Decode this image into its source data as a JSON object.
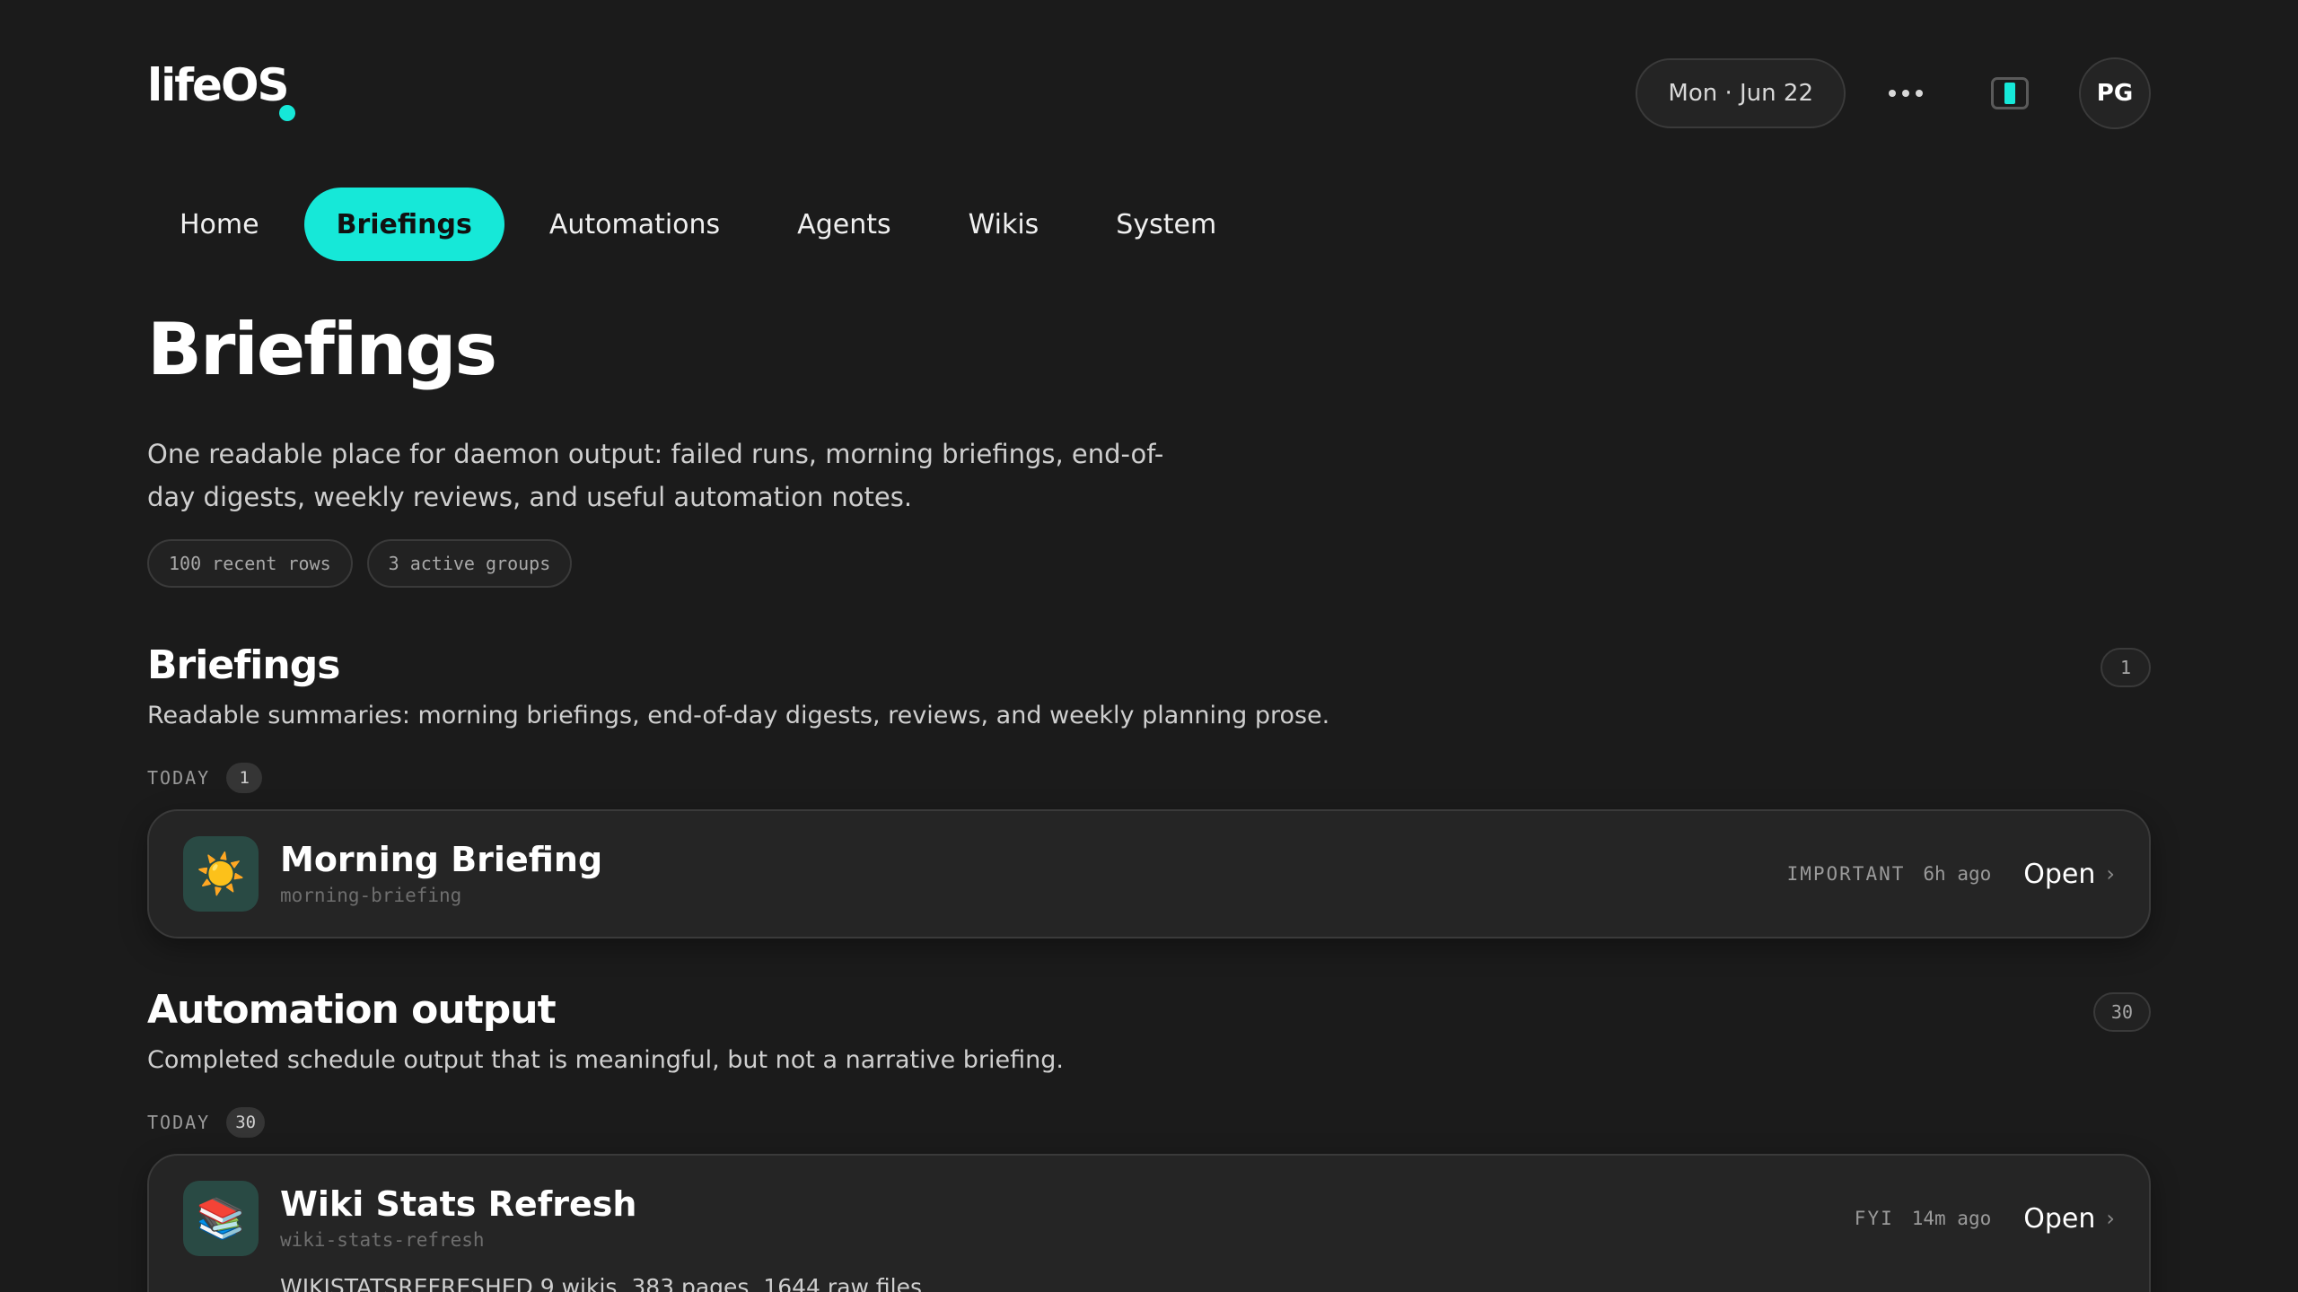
{
  "app": {
    "logo": "lifeOS",
    "accent": "#16e8d8"
  },
  "header": {
    "date": "Mon · Jun 22",
    "more_icon": "more-horizontal-icon",
    "theme_icon": "theme-toggle-icon",
    "avatar_initials": "PG"
  },
  "nav": {
    "items": [
      {
        "label": "Home"
      },
      {
        "label": "Briefings",
        "active": true
      },
      {
        "label": "Automations"
      },
      {
        "label": "Agents"
      },
      {
        "label": "Wikis"
      },
      {
        "label": "System"
      }
    ]
  },
  "page": {
    "title": "Briefings",
    "description": "One readable place for daemon output: failed runs, morning briefings, end-of-day digests, weekly reviews, and useful automation notes.",
    "chips": [
      "100 recent rows",
      "3 active groups"
    ]
  },
  "sections": [
    {
      "title": "Briefings",
      "description": "Readable summaries: morning briefings, end-of-day digests, reviews, and weekly planning prose.",
      "count": "1",
      "group": {
        "label": "TODAY",
        "count": "1"
      },
      "cards": [
        {
          "icon": "sun-icon",
          "glyph": "☀️",
          "title": "Morning Briefing",
          "slug": "morning-briefing",
          "priority": "IMPORTANT",
          "age": "6h ago",
          "action": "Open",
          "body": ""
        }
      ]
    },
    {
      "title": "Automation output",
      "description": "Completed schedule output that is meaningful, but not a narrative briefing.",
      "count": "30",
      "group": {
        "label": "TODAY",
        "count": "30"
      },
      "cards": [
        {
          "icon": "books-icon",
          "glyph": "📚",
          "title": "Wiki Stats Refresh",
          "slug": "wiki-stats-refresh",
          "priority": "FYI",
          "age": "14m ago",
          "action": "Open",
          "body": "WIKISTATSREFRESHED 9 wikis, 383 pages, 1644 raw files"
        }
      ]
    }
  ]
}
